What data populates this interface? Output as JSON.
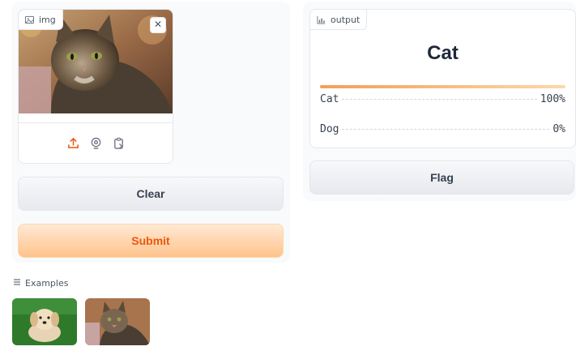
{
  "input": {
    "label": "img",
    "close_glyph": "✕",
    "sources": [
      "upload-icon",
      "webcam-icon",
      "clipboard-icon"
    ]
  },
  "buttons": {
    "clear": "Clear",
    "submit": "Submit",
    "flag": "Flag"
  },
  "output": {
    "label": "output",
    "prediction": "Cat",
    "confidences": [
      {
        "label": "Cat",
        "value": "100%"
      },
      {
        "label": "Dog",
        "value": "0%"
      }
    ]
  },
  "examples": {
    "label": "Examples",
    "items": [
      "dog-thumbnail",
      "cat-thumbnail"
    ]
  },
  "colors": {
    "accent": "#ea580c",
    "primary_gradient_start": "#ffe9d4",
    "primary_gradient_end": "#ffc38c"
  }
}
